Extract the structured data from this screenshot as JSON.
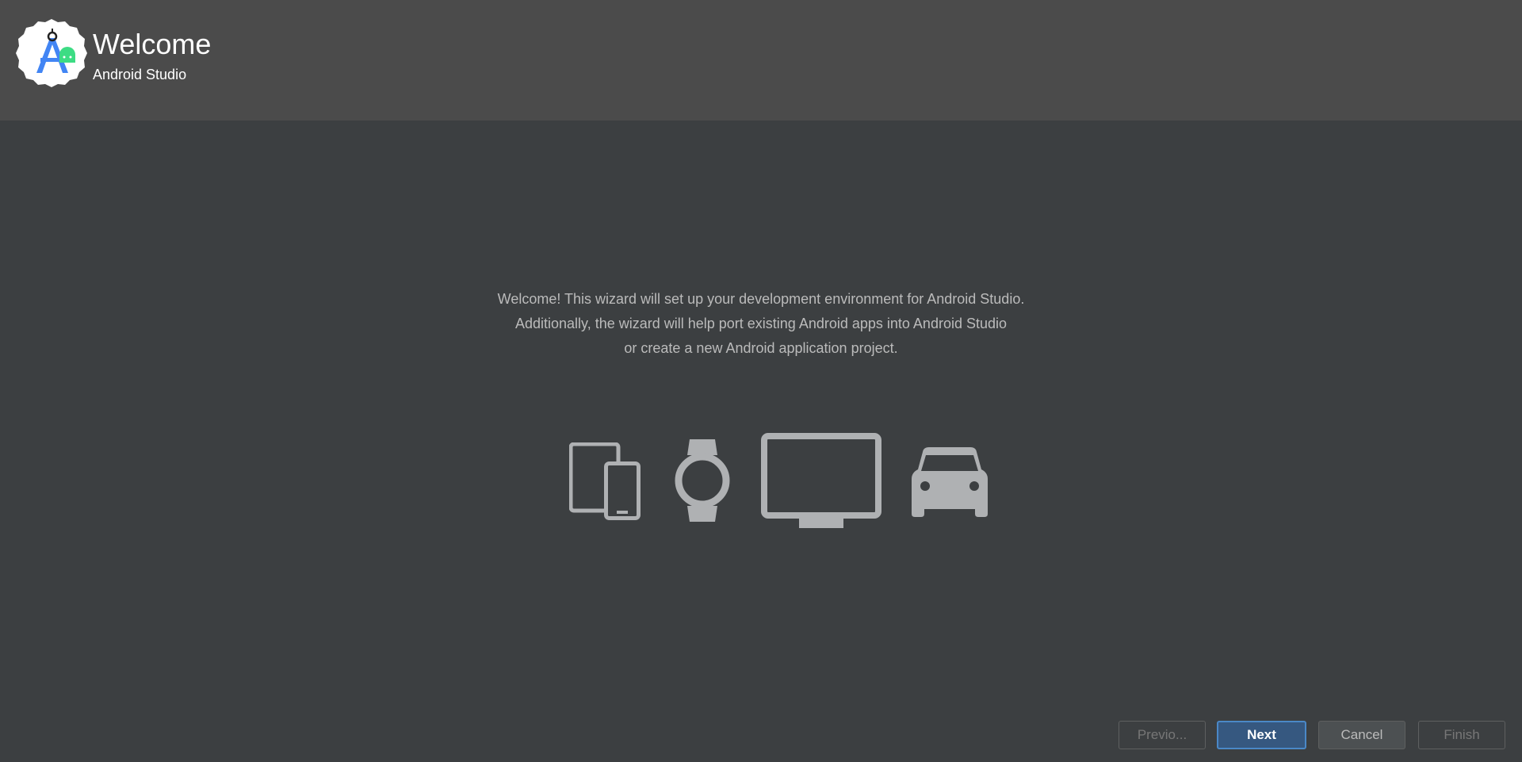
{
  "header": {
    "title": "Welcome",
    "subtitle": "Android Studio"
  },
  "message": {
    "lines": [
      "Welcome! This wizard will set up your development environment for Android Studio.",
      "Additionally, the wizard will help port existing Android apps into Android Studio",
      "or create a new Android application project."
    ]
  },
  "devices": {
    "icons": [
      "phone-tablet-icon",
      "watch-icon",
      "tv-icon",
      "car-icon"
    ]
  },
  "buttons": {
    "previous": "Previo...",
    "next": "Next",
    "cancel": "Cancel",
    "finish": "Finish"
  },
  "colors": {
    "header_bg": "#4b4b4b",
    "content_bg": "#3c3f41",
    "icon_gray": "#afb1b3",
    "primary_button": "#365880",
    "primary_border": "#4a88c7"
  }
}
